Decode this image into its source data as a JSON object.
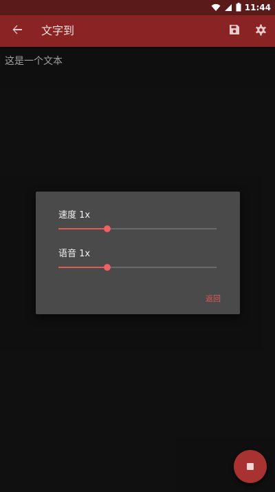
{
  "status_bar": {
    "time": "11:44"
  },
  "toolbar": {
    "title": "文字到"
  },
  "content": {
    "text": "这是一个文本"
  },
  "dialog": {
    "speed": {
      "label": "速度",
      "value_text": "1x",
      "fraction": 0.31
    },
    "pitch": {
      "label": "语音",
      "value_text": "1x",
      "fraction": 0.31
    },
    "action_label": "返回"
  },
  "colors": {
    "accent": "#e05a5a",
    "toolbar": "#8a2424",
    "status_bar": "#5a1a1a",
    "fab": "#a83232"
  },
  "icons": {
    "back": "arrow-left-icon",
    "save": "save-icon",
    "settings": "gear-icon",
    "stop": "stop-icon",
    "wifi": "wifi-icon",
    "signal": "signal-icon",
    "battery": "battery-icon"
  }
}
